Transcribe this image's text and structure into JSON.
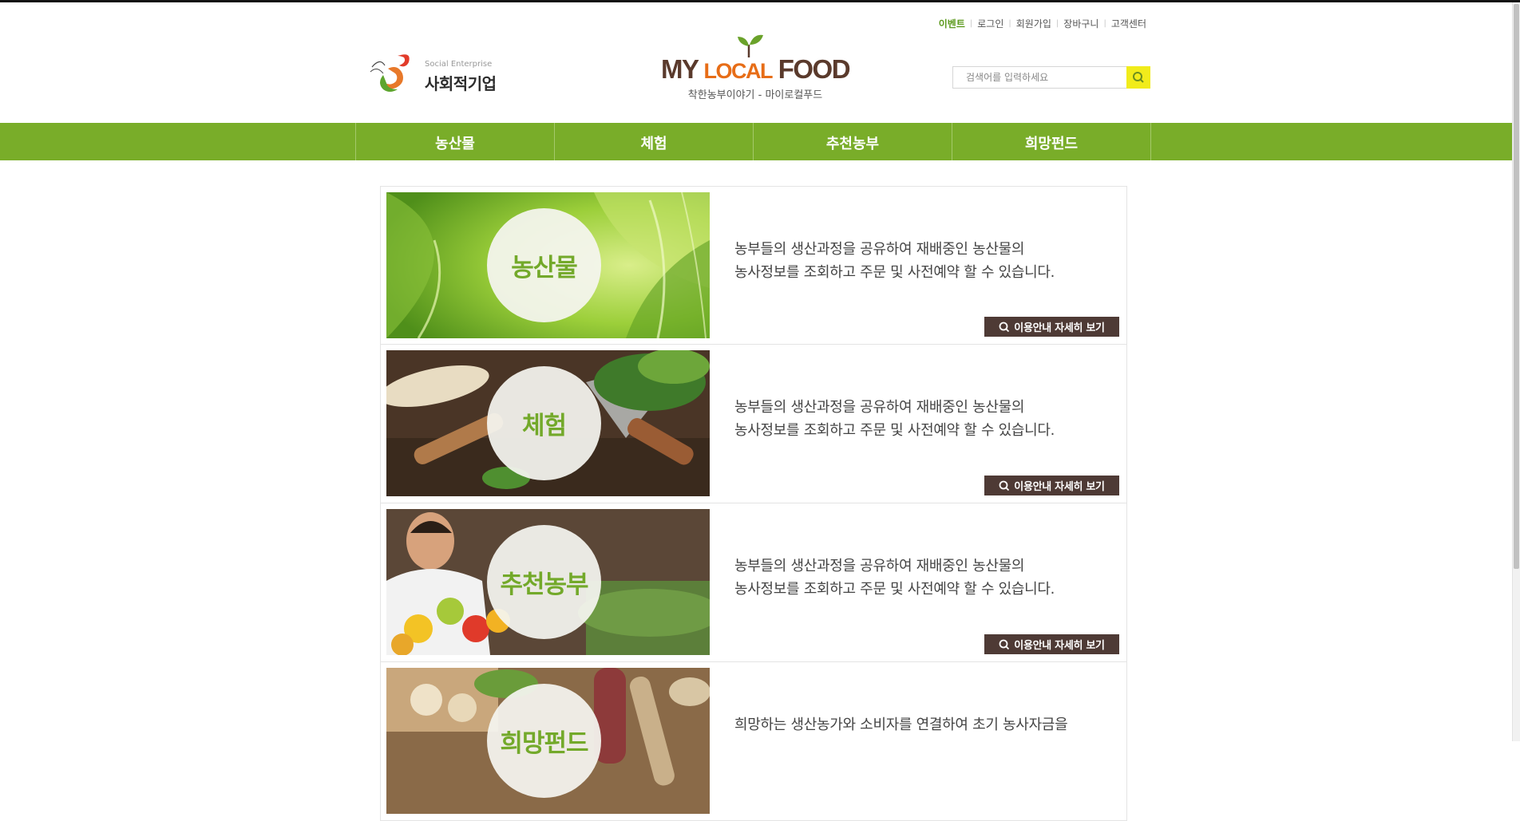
{
  "util_nav": [
    "이벤트",
    "로그인",
    "회원가입",
    "장바구니",
    "고객센터"
  ],
  "social_logo": {
    "small": "Social Enterprise",
    "big": "사회적기업"
  },
  "brand": {
    "my": "MY",
    "local": "LOCAL",
    "food": "FOOD",
    "tagline": "착한농부이야기 - 마이로컬푸드"
  },
  "search": {
    "placeholder": "검색어를 입력하세요",
    "icon": "search-icon"
  },
  "gnb": [
    "농산물",
    "체험",
    "추천농부",
    "희망펀드"
  ],
  "cards": [
    {
      "title": "농산물",
      "line1": "농부들의 생산과정을 공유하여 재배중인 농산물의",
      "line2": "농사정보를 조회하고 주문 및 사전예약 할 수 있습니다.",
      "button": "이용안내 자세히 보기"
    },
    {
      "title": "체험",
      "line1": "농부들의 생산과정을 공유하여 재배중인 농산물의",
      "line2": "농사정보를 조회하고 주문 및 사전예약 할 수 있습니다.",
      "button": "이용안내 자세히 보기"
    },
    {
      "title": "추천농부",
      "line1": "농부들의 생산과정을 공유하여 재배중인 농산물의",
      "line2": "농사정보를 조회하고 주문 및 사전예약 할 수 있습니다.",
      "button": "이용안내 자세히 보기"
    },
    {
      "title": "희망펀드",
      "line1": "희망하는 생산농가와 소비자를 연결하여 초기 농사자금을",
      "line2": "",
      "button": ""
    }
  ],
  "colors": {
    "green_nav": "#79ad29",
    "accent_green": "#73a92a",
    "brand_brown": "#5a3a2c",
    "brand_orange": "#e76d17",
    "button_brown": "#4e3a35",
    "search_yellow": "#f1ec1b"
  }
}
